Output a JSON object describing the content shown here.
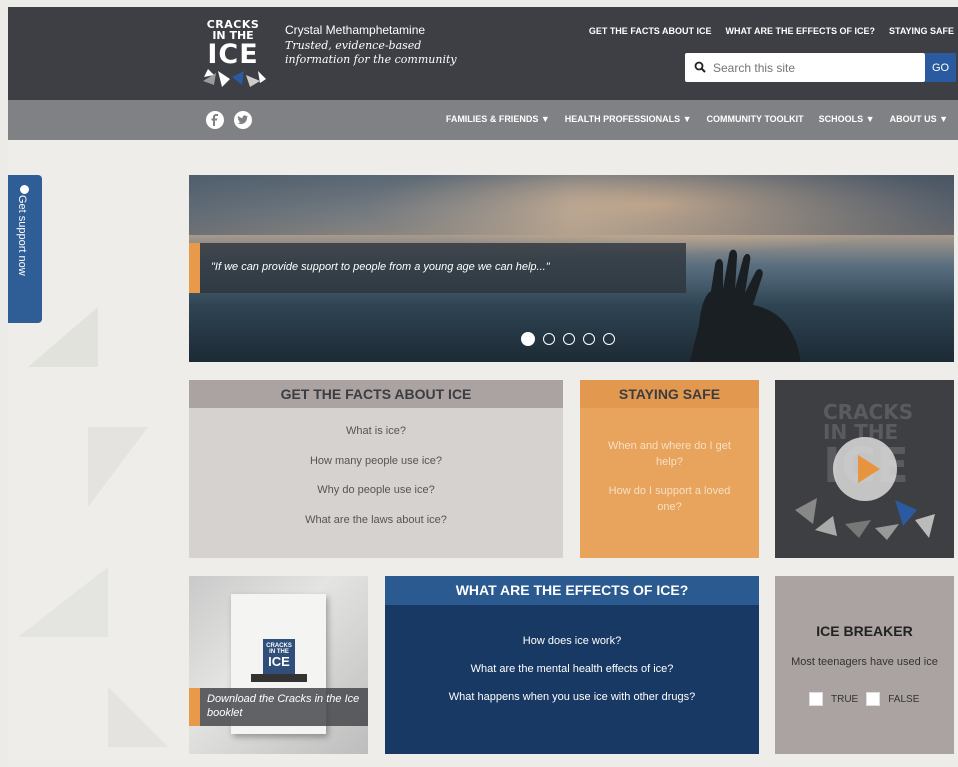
{
  "header": {
    "logo": {
      "line1": "CRACKS",
      "line2": "IN THE",
      "line3": "ICE"
    },
    "tagline_title": "Crystal Methamphetamine",
    "tagline_line1": "Trusted, evidence-based",
    "tagline_line2": "information for the community",
    "top_nav": [
      "GET THE FACTS ABOUT ICE",
      "WHAT ARE THE EFFECTS OF ICE?",
      "STAYING SAFE"
    ],
    "search": {
      "placeholder": "Search this site",
      "button": "GO"
    }
  },
  "subnav": {
    "social_icons": [
      "facebook-icon",
      "twitter-icon"
    ],
    "items": [
      "FAMILIES & FRIENDS ▼",
      "HEALTH PROFESSIONALS ▼",
      "COMMUNITY TOOLKIT",
      "SCHOOLS ▼",
      "ABOUT US ▼"
    ]
  },
  "side_tab": {
    "label": "Get support now"
  },
  "hero": {
    "quote": "\"If we can provide support to people from a young age we can help...\"",
    "slide_count": 5,
    "active_slide": 1
  },
  "facts_card": {
    "title": "GET THE FACTS ABOUT ICE",
    "links": [
      "What is ice?",
      "How many people use ice?",
      "Why do people use ice?",
      "What are the laws about ice?"
    ]
  },
  "safe_card": {
    "title": "STAYING SAFE",
    "links": [
      "When and where do I get help?",
      "How do I support a loved one?"
    ]
  },
  "video_card": {
    "logo_line1": "CRACKS",
    "logo_line2": "IN THE",
    "logo_line3": "ICE"
  },
  "booklet_card": {
    "cover_line1": "CRACKS",
    "cover_line2": "IN THE",
    "cover_line3": "ICE",
    "label": "Download the Cracks in the Ice booklet"
  },
  "effects_card": {
    "title": "WHAT ARE THE EFFECTS OF ICE?",
    "links": [
      "How does ice work?",
      "What are the mental health effects of ice?",
      "What happens when you use ice with other drugs?"
    ]
  },
  "breaker_card": {
    "title": "ICE BREAKER",
    "question": "Most teenagers have used ice",
    "option_true": "TRUE",
    "option_false": "FALSE"
  },
  "colors": {
    "header_bg": "#3d3f44",
    "subnav_bg": "#808184",
    "accent_orange": "#e89a4a",
    "accent_blue": "#2a5aa0",
    "effects_bg": "#183964"
  }
}
